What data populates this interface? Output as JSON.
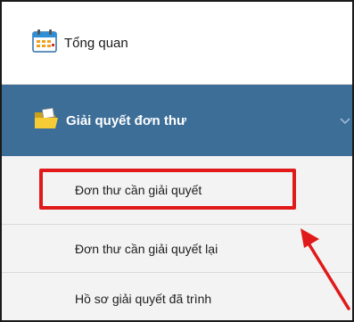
{
  "menu": {
    "overview": {
      "label": "Tổng quan",
      "icon": "calendar-icon"
    },
    "resolve_petitions": {
      "label": "Giải quyết đơn thư",
      "icon": "folder-open-icon",
      "expand_icon": "chevron-down-icon",
      "active_color": "#3d6e98",
      "children": [
        {
          "label": "Đơn thư cần giải quyết"
        },
        {
          "label": "Đơn thư cần giải quyết lại"
        },
        {
          "label": "Hồ sơ giải quyết đã trình"
        }
      ]
    }
  },
  "annotation": {
    "highlight_color": "#e01a1a"
  }
}
